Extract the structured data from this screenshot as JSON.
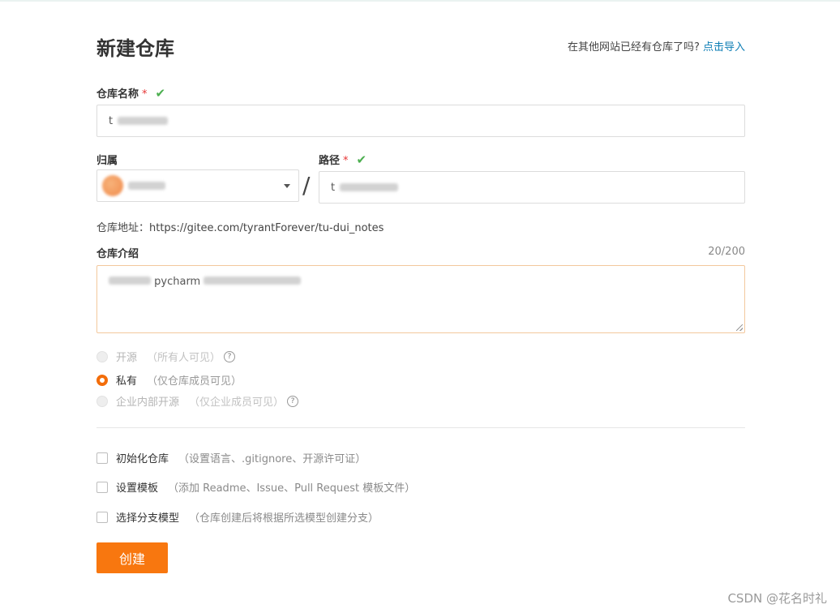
{
  "header": {
    "title": "新建仓库",
    "import_prompt": "在其他网站已经有仓库了吗?",
    "import_link": "点击导入"
  },
  "repo_name": {
    "label": "仓库名称",
    "required_mark": "*",
    "check": "✔",
    "value": "t"
  },
  "owner": {
    "label": "归属",
    "value": ""
  },
  "separator": "/",
  "path": {
    "label": "路径",
    "required_mark": "*",
    "check": "✔",
    "value": "t"
  },
  "repo_address": "仓库地址：https://gitee.com/tyrantForever/tu-dui_notes",
  "description": {
    "label": "仓库介绍",
    "counter": "20/200",
    "value": "pycharm"
  },
  "visibility": [
    {
      "label": "开源",
      "hint": "（所有人可见）",
      "state": "disabled",
      "help": "?"
    },
    {
      "label": "私有",
      "hint": "（仅仓库成员可见）",
      "state": "checked"
    },
    {
      "label": "企业内部开源",
      "hint": "（仅企业成员可见）",
      "state": "disabled",
      "help": "?"
    }
  ],
  "options": [
    {
      "label": "初始化仓库",
      "hint": "（设置语言、.gitignore、开源许可证）"
    },
    {
      "label": "设置模板",
      "hint": "（添加 Readme、Issue、Pull Request 模板文件）"
    },
    {
      "label": "选择分支模型",
      "hint": "（仓库创建后将根据所选模型创建分支）"
    }
  ],
  "submit_label": "创建",
  "watermark": "CSDN @花名时礼",
  "colors": {
    "accent": "#f8770f",
    "link": "#0e7eb5",
    "required": "#e63535",
    "check": "#4caf50"
  }
}
